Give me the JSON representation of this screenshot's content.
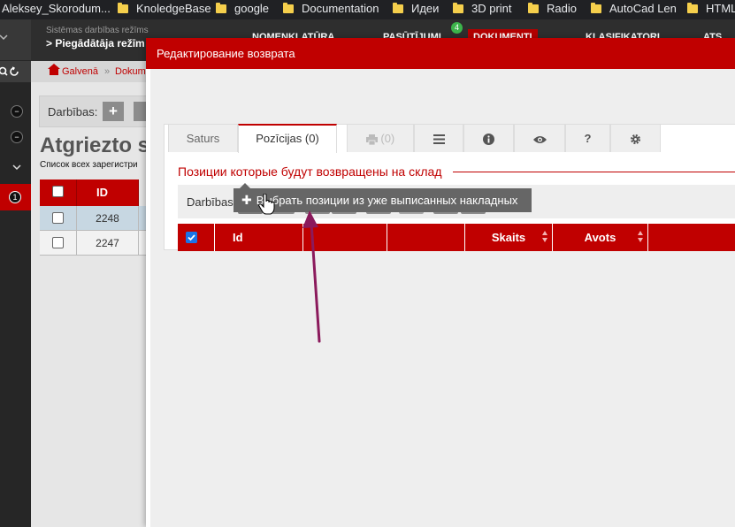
{
  "bookmarks": [
    {
      "label": "Aleksey_Skorodum...",
      "folder": false
    },
    {
      "label": "KnoledgeBase",
      "folder": true
    },
    {
      "label": "google",
      "folder": true
    },
    {
      "label": "Documentation",
      "folder": true
    },
    {
      "label": "Идеи",
      "folder": true
    },
    {
      "label": "3D print",
      "folder": true
    },
    {
      "label": "Radio",
      "folder": true
    },
    {
      "label": "AutoCad Len",
      "folder": true
    },
    {
      "label": "HTML",
      "folder": true
    }
  ],
  "app": {
    "mode_label": "Sistēmas darbības režīms",
    "mode_value": "> Piegādātāja režīm",
    "nav": [
      {
        "label": "NOMENKLATŪRA"
      },
      {
        "label": "PASŪTĪJUMI"
      },
      {
        "label": "DOKUMENTI"
      },
      {
        "label": "KLASIFIKATORI"
      },
      {
        "label": "ATS"
      }
    ],
    "nav_badge": "4",
    "breadcrumb_home": "Galvenā",
    "breadcrumb_sep": "»",
    "breadcrumb_item": "Dokum",
    "actions_label": "Darbības:",
    "page_title": "Atgriezto s",
    "page_subtitle": "Список всех зарегистри",
    "table_header_id": "ID",
    "rows": [
      {
        "id": "2248"
      },
      {
        "id": "2247"
      }
    ],
    "sidebar_badge": "1"
  },
  "modal": {
    "title": "Редактирование возврата",
    "tabs": [
      {
        "label": "Saturs"
      },
      {
        "label": "Pozīcijas (0)"
      },
      {
        "label": "(0)"
      }
    ],
    "section_title": "Позиции которые будут возвращены на склад",
    "actions_label": "Darbības:",
    "columns": [
      {
        "label": "Id"
      },
      {
        "label": "Skaits"
      },
      {
        "label": "Avots"
      }
    ],
    "tooltip": "Выбрать позиции из уже выписанных накладных"
  },
  "colors": {
    "accent": "#c00000",
    "toolbar_button": "#8c8c8c",
    "tooltip_bg": "#666666",
    "annotation_arrow": "#8b1a5c"
  },
  "icons": {
    "add": "plus-icon",
    "refresh": "refresh-icon",
    "excel": "excel-icon",
    "print": "print-icon",
    "columns": "list-icon",
    "delete": "trash-icon",
    "info": "info-icon",
    "expand": "expand-icon",
    "view": "eye-icon",
    "help": "question-icon",
    "settings": "gear-icon"
  }
}
